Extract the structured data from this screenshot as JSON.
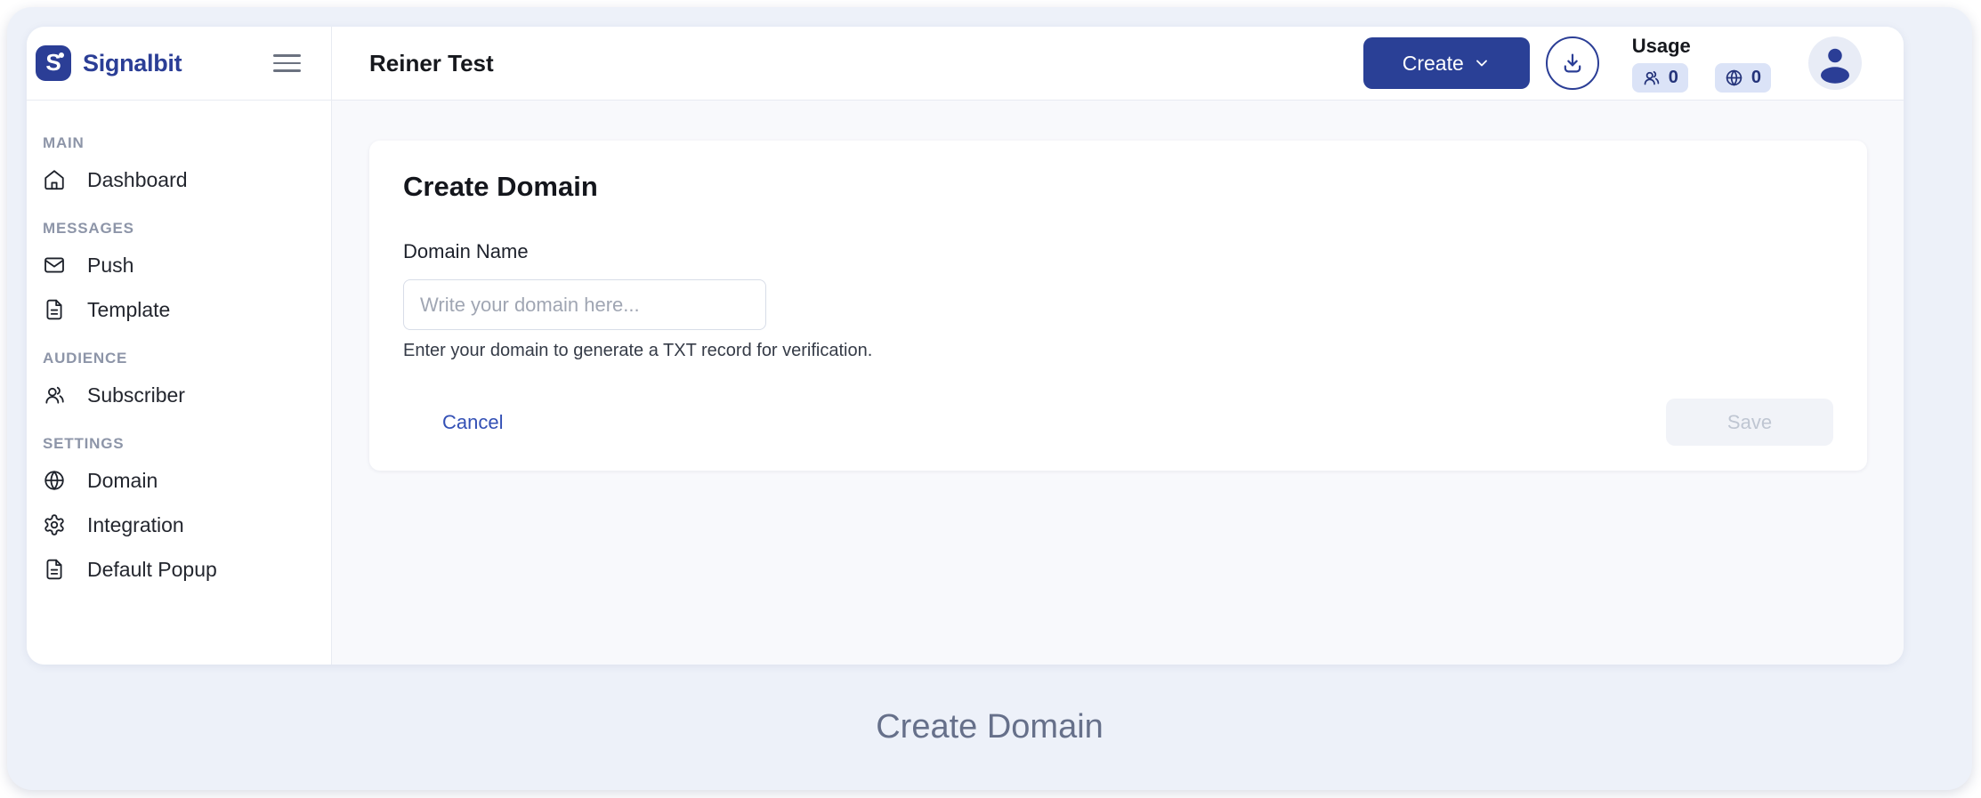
{
  "brand": {
    "name": "Signalbit",
    "logo_icon": "signalbit-logo-icon"
  },
  "header": {
    "title": "Reiner Test",
    "create_label": "Create",
    "usage_label": "Usage",
    "subscriber_count": "0",
    "domain_count": "0",
    "icons": [
      "chevron-down-icon",
      "download-icon",
      "users-icon",
      "globe-icon",
      "avatar-person-icon",
      "hamburger-menu-icon"
    ]
  },
  "sidebar": {
    "sections": [
      {
        "label": "MAIN",
        "items": [
          {
            "label": "Dashboard",
            "icon": "home-icon"
          }
        ]
      },
      {
        "label": "MESSAGES",
        "items": [
          {
            "label": "Push",
            "icon": "mail-icon"
          },
          {
            "label": "Template",
            "icon": "file-text-icon"
          }
        ]
      },
      {
        "label": "AUDIENCE",
        "items": [
          {
            "label": "Subscriber",
            "icon": "users-icon"
          }
        ]
      },
      {
        "label": "SETTINGS",
        "items": [
          {
            "label": "Domain",
            "icon": "globe-icon"
          },
          {
            "label": "Integration",
            "icon": "gear-icon"
          },
          {
            "label": "Default Popup",
            "icon": "file-text-icon"
          }
        ]
      }
    ]
  },
  "card": {
    "title": "Create Domain",
    "field_label": "Domain Name",
    "input_value": "",
    "input_placeholder": "Write your domain here...",
    "helper": "Enter your domain to generate a TXT record for verification.",
    "cancel_label": "Cancel",
    "save_label": "Save",
    "save_state": "disabled"
  },
  "footer": {
    "title": "Create Domain"
  },
  "colors": {
    "accent": "#2a4096",
    "outer_background": "#edf1f9",
    "content_background": "#f8f9fc",
    "badge_background": "#dbe3f7",
    "footer_text": "#66708a",
    "save_disabled_bg": "#f1f3f8"
  }
}
